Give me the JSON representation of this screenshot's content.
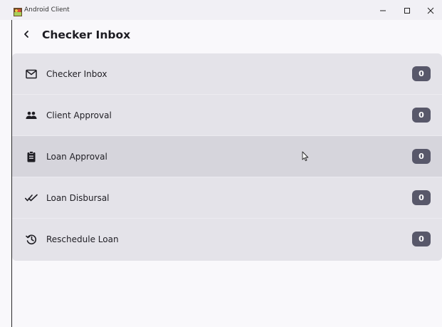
{
  "window": {
    "title": "Android Client",
    "minimize_icon": "minimize-icon",
    "maximize_icon": "maximize-icon",
    "close_icon": "close-icon"
  },
  "header": {
    "back_icon": "chevron-left-icon",
    "title": "Checker Inbox"
  },
  "items": [
    {
      "icon": "mail-icon",
      "label": "Checker Inbox",
      "count": "0"
    },
    {
      "icon": "people-icon",
      "label": "Client Approval",
      "count": "0"
    },
    {
      "icon": "clipboard-icon",
      "label": "Loan Approval",
      "count": "0"
    },
    {
      "icon": "double-check-icon",
      "label": "Loan Disbursal",
      "count": "0"
    },
    {
      "icon": "history-icon",
      "label": "Reschedule Loan",
      "count": "0"
    }
  ],
  "colors": {
    "background": "#f9f8fb",
    "list_background": "#e4e3e9",
    "hover_row": "#d6d5dc",
    "badge": "#58586a",
    "text": "#1c1b21"
  }
}
